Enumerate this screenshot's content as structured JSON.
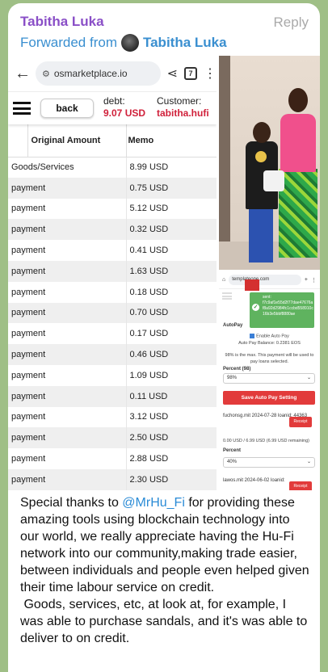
{
  "header": {
    "sender": "Tabitha Luka",
    "reply": "Reply",
    "forwarded_prefix": "Forwarded from",
    "forwarded_name": "Tabitha Luka"
  },
  "browser": {
    "url": "osmarketplace.io",
    "tabs_count": "7"
  },
  "app": {
    "back_label": "back",
    "debt_label": "debt:",
    "debt_value": "9.07 USD",
    "customer_label": "Customer:",
    "customer_value": "tabitha.hufi"
  },
  "table": {
    "headers": [
      "Original Amount",
      "Memo"
    ],
    "rows": [
      {
        "memo": "Goods/Services",
        "amount": "8.99 USD"
      },
      {
        "memo": "payment",
        "amount": "0.75 USD"
      },
      {
        "memo": "payment",
        "amount": "5.12 USD"
      },
      {
        "memo": "payment",
        "amount": "0.32 USD"
      },
      {
        "memo": "payment",
        "amount": "0.41 USD"
      },
      {
        "memo": "payment",
        "amount": "1.63 USD"
      },
      {
        "memo": "payment",
        "amount": "0.18 USD"
      },
      {
        "memo": "payment",
        "amount": "0.70 USD"
      },
      {
        "memo": "payment",
        "amount": "0.17 USD"
      },
      {
        "memo": "payment",
        "amount": "0.46 USD"
      },
      {
        "memo": "payment",
        "amount": "1.09 USD"
      },
      {
        "memo": "payment",
        "amount": "0.11 USD"
      },
      {
        "memo": "payment",
        "amount": "3.12 USD"
      },
      {
        "memo": "payment",
        "amount": "2.50 USD"
      },
      {
        "memo": "payment",
        "amount": "2.88 USD"
      },
      {
        "memo": "payment",
        "amount": "2.30 USD"
      }
    ]
  },
  "autopay": {
    "url": "templateone.com",
    "toast": "sent: f7c9af1e55d2f77dae47676a f8a92d2984fc1ccbd558910c 16b3e5bbf8880ae",
    "section": "AutoPay",
    "enable_label": "Enable Auto Pay",
    "balance": "Auto Pay Balance: 0.2381 EOS",
    "note": "98% is the max. This payment will be used to pay loans selected.",
    "percent_label": "Percent (98)",
    "percent_value": "98%",
    "save_button": "Save Auto Pay Setting",
    "loan1": "fuchonsg.mit 2024-07-28 loanid: 44363",
    "receipt": "Receipt",
    "loan1_remaining": "0.00 USD / 6.99 USD (6.99 USD remaining)",
    "percent2_label": "Percent",
    "percent2_value": "40%",
    "loan2": "lawos.mit 2024-06-02 loanid:"
  },
  "message": {
    "text_before": "Special thanks to ",
    "mention": "@MrHu_Fi",
    "text_after": " for providing these amazing tools using blockchain technology into our world, we really appreciate having the Hu-Fi network into our community,making trade easier, between individuals and people even helped given their time labour service on credit.\n Goods, services, etc, at look at, for example, I was able to purchase sandals, and it's was able to deliver to on credit."
  }
}
